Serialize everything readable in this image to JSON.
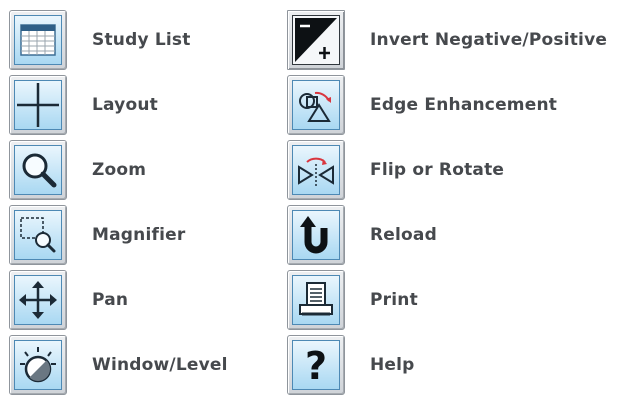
{
  "legend": {
    "left": [
      {
        "icon": "study-list-icon",
        "label": "Study List"
      },
      {
        "icon": "layout-icon",
        "label": "Layout"
      },
      {
        "icon": "zoom-icon",
        "label": "Zoom"
      },
      {
        "icon": "magnifier-icon",
        "label": "Magnifier"
      },
      {
        "icon": "pan-icon",
        "label": "Pan"
      },
      {
        "icon": "window-level-icon",
        "label": "Window/Level"
      }
    ],
    "right": [
      {
        "icon": "invert-icon",
        "label": "Invert Negative/Positive"
      },
      {
        "icon": "edge-enhancement-icon",
        "label": "Edge Enhancement"
      },
      {
        "icon": "flip-rotate-icon",
        "label": "Flip or Rotate"
      },
      {
        "icon": "reload-icon",
        "label": "Reload"
      },
      {
        "icon": "print-icon",
        "label": "Print"
      },
      {
        "icon": "help-icon",
        "label": "Help"
      }
    ]
  },
  "colors": {
    "icon_face_top": "#eaf6fd",
    "icon_face_bottom": "#a9d8f2",
    "icon_stroke": "#1b2a36",
    "label_text": "#46494d",
    "accent_red": "#d9363e"
  }
}
